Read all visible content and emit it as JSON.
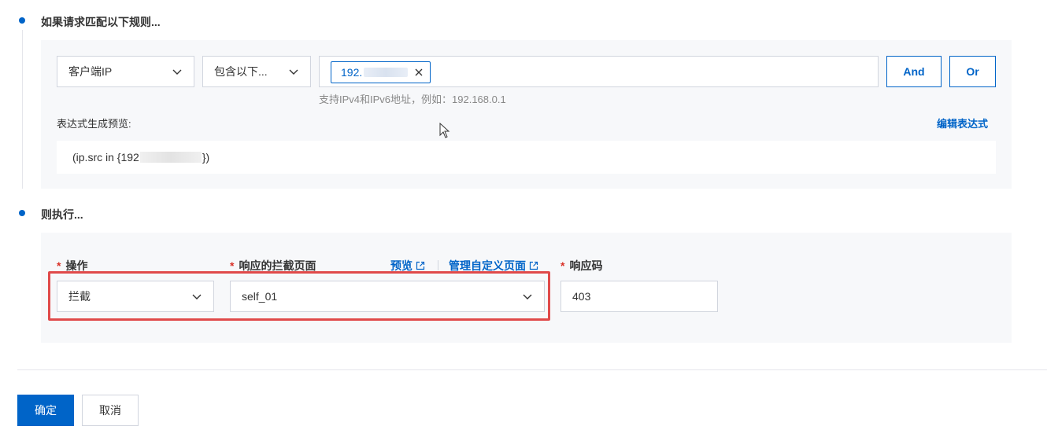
{
  "step1": {
    "title": "如果请求匹配以下规则..."
  },
  "condition": {
    "field_select": "客户端IP",
    "operator_select": "包含以下...",
    "tag_value": "192.",
    "hint": "支持IPv4和IPv6地址，例如：192.168.0.1",
    "and_label": "And",
    "or_label": "Or"
  },
  "expression": {
    "preview_label": "表达式生成预览:",
    "edit_link": "编辑表达式",
    "prefix": "(ip.src in {192",
    "suffix": "})"
  },
  "step2": {
    "title": "则执行..."
  },
  "action": {
    "operation_label": "操作",
    "operation_value": "拦截",
    "block_page_label": "响应的拦截页面",
    "preview_link": "预览",
    "manage_link": "管理自定义页面",
    "block_page_value": "self_01",
    "response_code_label": "响应码",
    "response_code_value": "403",
    "required_mark": "*"
  },
  "footer": {
    "confirm_label": "确定",
    "cancel_label": "取消"
  },
  "colors": {
    "accent": "#0064c8",
    "highlight": "#e04a4a",
    "required": "#d93026"
  }
}
